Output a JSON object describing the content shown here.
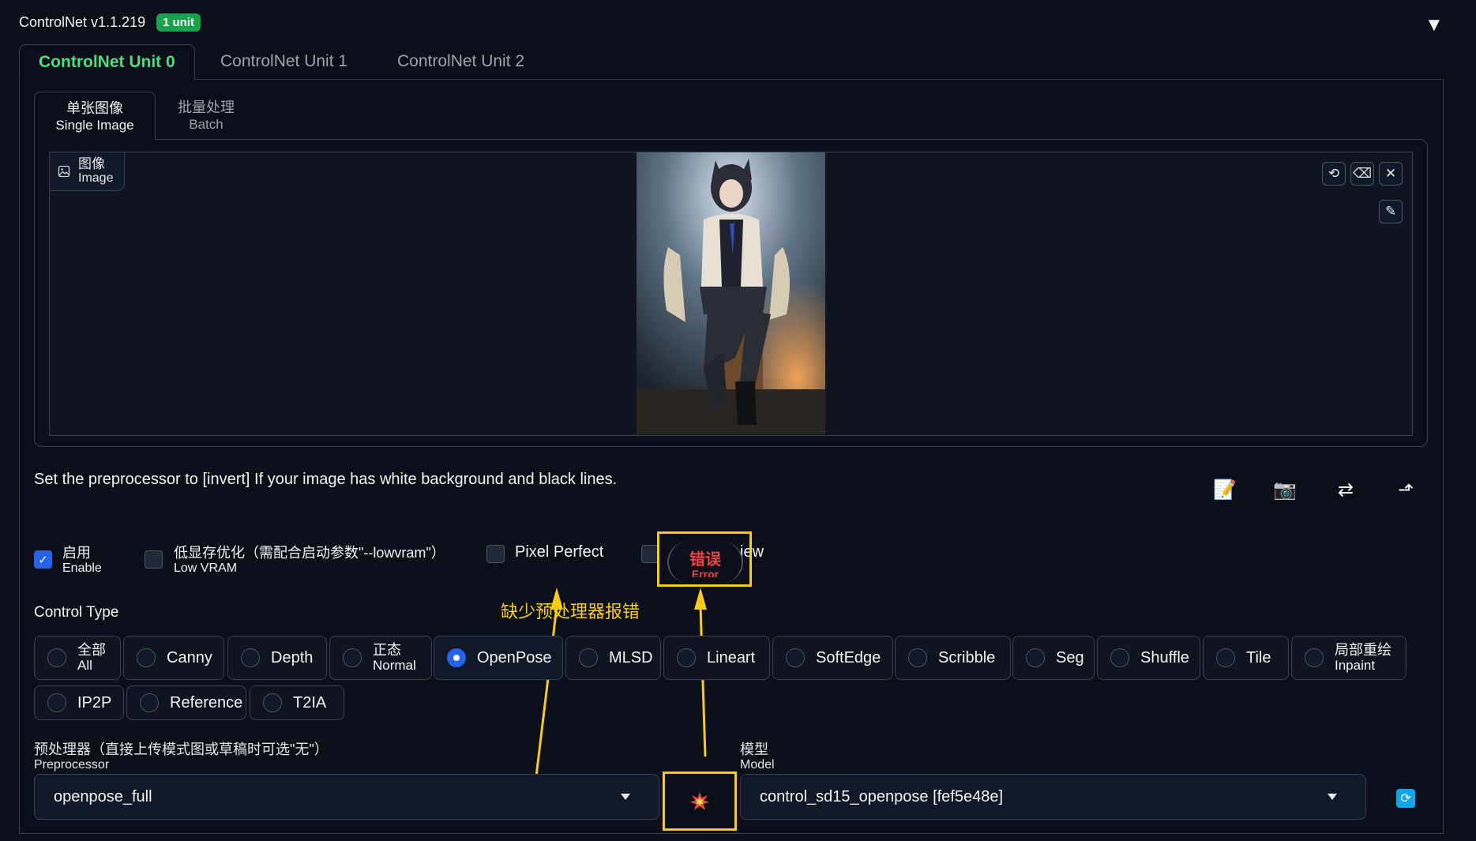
{
  "header": {
    "title": "ControlNet v1.1.219",
    "badge": "1 unit",
    "collapse_icon": "▼"
  },
  "unit_tabs": [
    {
      "label": "ControlNet Unit 0",
      "active": true
    },
    {
      "label": "ControlNet Unit 1",
      "active": false
    },
    {
      "label": "ControlNet Unit 2",
      "active": false
    }
  ],
  "input_tabs": [
    {
      "zh": "单张图像",
      "en": "Single Image",
      "active": true
    },
    {
      "zh": "批量处理",
      "en": "Batch",
      "active": false
    }
  ],
  "image_panel": {
    "label_zh": "图像",
    "label_en": "Image"
  },
  "hint_text": "Set the preprocessor to [invert] If your image has white background and black lines.",
  "options": {
    "enable": {
      "zh": "启用",
      "en": "Enable",
      "checked": true
    },
    "low_vram": {
      "zh": "低显存优化（需配合启动参数\"--lowvram\"）",
      "en": "Low VRAM",
      "checked": false
    },
    "pixel_perfect": {
      "label": "Pixel Perfect",
      "checked": false
    },
    "preview_suffix": "iew"
  },
  "error_badge": {
    "zh": "错误",
    "en": "Error"
  },
  "annotation": "缺少预处理器报错",
  "control_type": {
    "label": "Control Type",
    "options": [
      {
        "zh": "全部",
        "en": "All"
      },
      {
        "label": "Canny"
      },
      {
        "label": "Depth"
      },
      {
        "zh": "正态",
        "en": "Normal"
      },
      {
        "label": "OpenPose",
        "selected": true
      },
      {
        "label": "MLSD"
      },
      {
        "label": "Lineart"
      },
      {
        "label": "SoftEdge"
      },
      {
        "label": "Scribble"
      },
      {
        "label": "Seg"
      },
      {
        "label": "Shuffle"
      },
      {
        "label": "Tile"
      },
      {
        "zh": "局部重绘",
        "en": "Inpaint"
      },
      {
        "label": "IP2P"
      },
      {
        "label": "Reference"
      },
      {
        "label": "T2IA"
      }
    ]
  },
  "preprocessor": {
    "label_zh": "预处理器（直接上传模式图或草稿时可选\"无\"）",
    "label_en": "Preprocessor",
    "value": "openpose_full"
  },
  "model": {
    "label_zh": "模型",
    "label_en": "Model",
    "value": "control_sd15_openpose [fef5e48e]"
  },
  "colors": {
    "accent_green": "#4ade80",
    "annotation_yellow": "#facc15",
    "selected_blue": "#2563eb",
    "error_red": "#ef4444"
  }
}
